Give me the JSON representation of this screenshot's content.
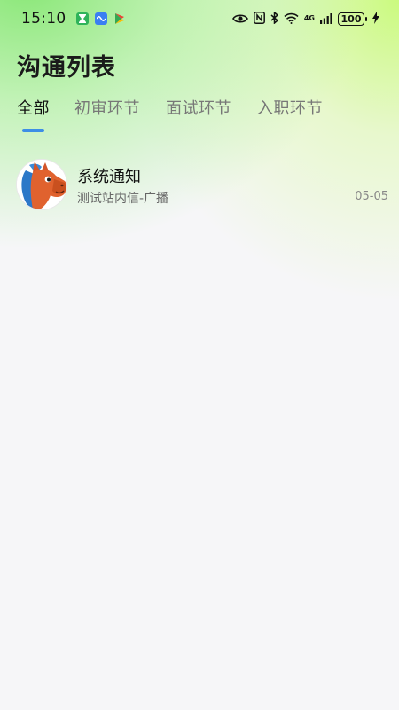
{
  "status_bar": {
    "time": "15:10",
    "network": "4G",
    "battery": "100"
  },
  "header": {
    "title": "沟通列表"
  },
  "tabs": [
    {
      "label": "全部",
      "active": true
    },
    {
      "label": "初审环节",
      "active": false
    },
    {
      "label": "面试环节",
      "active": false
    },
    {
      "label": "入职环节",
      "active": false
    }
  ],
  "colors": {
    "accent": "#3d8ee6",
    "gradient_green": "#86e66e",
    "gradient_lime": "#c8fa78"
  },
  "messages": [
    {
      "title": "系统通知",
      "subtitle": "测试站内信-广播",
      "time": "05-05",
      "avatar_icon": "horse-mascot-icon"
    }
  ]
}
